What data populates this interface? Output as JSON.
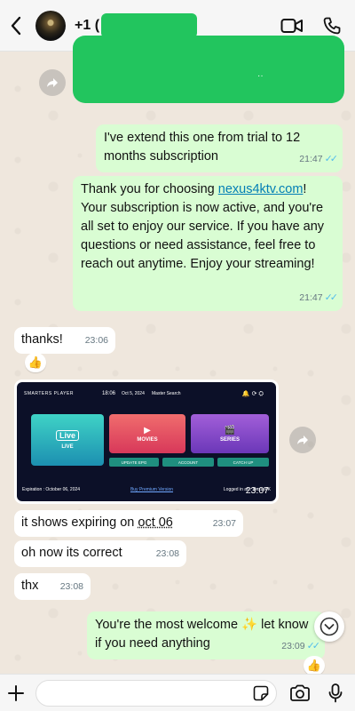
{
  "header": {
    "contact_prefix": "+1 (",
    "back_icon": "chevron-left-icon",
    "video_icon": "video-camera-icon",
    "call_icon": "phone-icon"
  },
  "messages": [
    {
      "type": "outgoing",
      "text": "",
      "redacted": true,
      "extra": "··"
    },
    {
      "type": "outgoing",
      "text": "I've extend this one from trial to 12 months subscription",
      "time": "21:47",
      "read": true
    },
    {
      "type": "outgoing",
      "text_before_link": "Thank you for choosing ",
      "link": "nexus4ktv.com",
      "text_after_link": "! Your subscription is now active, and you're all set to enjoy our service. If you have any questions or need assistance, feel free to reach out anytime. Enjoy your streaming!",
      "time": "21:47",
      "read": true
    },
    {
      "type": "incoming",
      "text": "thanks!",
      "time": "23:06",
      "reaction": "👍"
    },
    {
      "type": "incoming-image",
      "time": "23:07",
      "screenshot": {
        "logo": "SMARTERS PLAYER",
        "clock": "18:06",
        "date": "Oct 5, 2024",
        "search": "Master Search",
        "tiles": [
          "LIVE",
          "MOVIES",
          "SERIES"
        ],
        "small_tiles": [
          "UPDATE EPG",
          "ACCOUNT",
          "CATCH UP"
        ],
        "expiration": "Expiration : October 06, 2024",
        "buy": "Buy Premium Version",
        "logged_in": "Logged in as : Nexus4K"
      }
    },
    {
      "type": "incoming",
      "text_before": "it shows expiring on ",
      "underlined": "oct 06",
      "time": "23:07"
    },
    {
      "type": "incoming",
      "text": "oh now its correct",
      "time": "23:08"
    },
    {
      "type": "incoming",
      "text": "thx",
      "time": "23:08"
    },
    {
      "type": "outgoing",
      "text_before": "You're the most welcome ",
      "emoji": "✨",
      "text_after": " let know if you need anything",
      "time": "23:09",
      "read": true,
      "reaction": "👍"
    }
  ],
  "input": {
    "plus_icon": "plus-icon",
    "sticker_icon": "sticker-icon",
    "camera_icon": "camera-icon",
    "mic_icon": "microphone-icon"
  },
  "colors": {
    "outgoing_bubble": "#d9fdd3",
    "incoming_bubble": "#ffffff",
    "read_ticks": "#53bdeb",
    "link": "#027eb5",
    "redaction": "#22c55e"
  }
}
